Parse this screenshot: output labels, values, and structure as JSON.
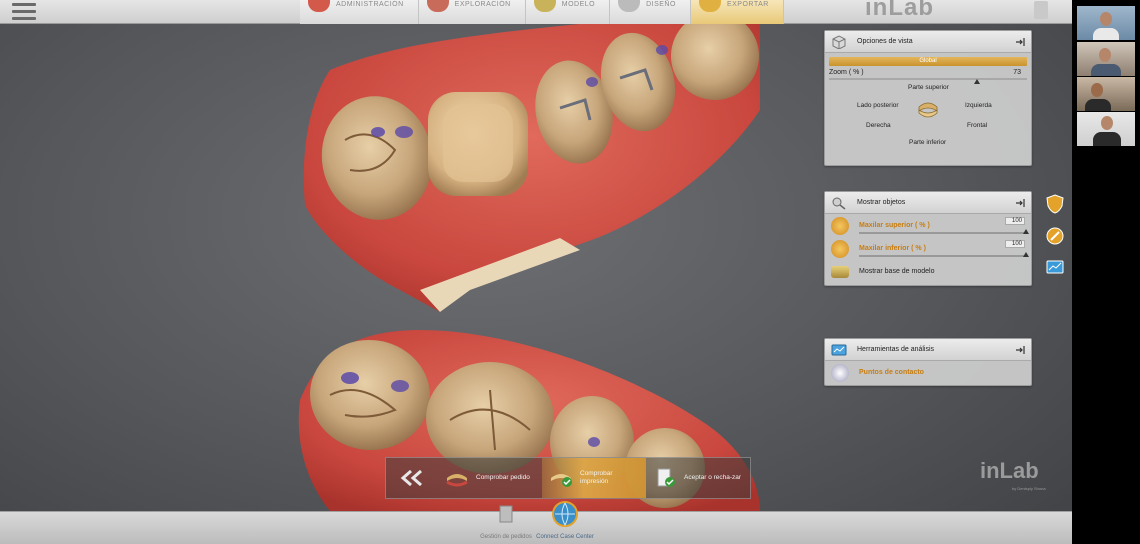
{
  "topbar": {
    "phases": [
      {
        "label": "ADMINISTRACIÓN",
        "color": "#d35a4a"
      },
      {
        "label": "EXPLORACIÓN",
        "color": "#c96b5a"
      },
      {
        "label": "MODELO",
        "color": "#c9b35a"
      },
      {
        "label": "DISEÑO",
        "color": "#aaaaaa"
      },
      {
        "label": "EXPORTAR",
        "color": "#e0b040"
      }
    ],
    "brand": "inLab"
  },
  "view_options": {
    "title": "Opciones de vista",
    "global_label": "Global",
    "zoom_label": "Zoom ( % )",
    "zoom_value": "73",
    "zoom_fraction": 0.73,
    "top_label": "Parte superior",
    "back_label": "Lado posterior",
    "left_label": "Izquierda",
    "right_label": "Derecha",
    "front_label": "Frontal",
    "bottom_label": "Parte inferior"
  },
  "show_objects": {
    "title": "Mostrar objetos",
    "upper_label": "Maxilar superior  ( % )",
    "upper_value": "100",
    "lower_label": "Maxilar inferior  ( % )",
    "lower_value": "100",
    "base_label": "Mostrar base de modelo"
  },
  "analysis_tools": {
    "title": "Herramientas de análisis",
    "contact_label": "Puntos de contacto"
  },
  "workflow": {
    "step1": "Comprobar pedido",
    "step2": "Comprobar impresión",
    "step3": "Aceptar o recha-zar"
  },
  "brand_bottom": "inLab",
  "brand_bottom_sub": "by Dentsply Sirona",
  "footer": {
    "orders": "Gestión de pedidos",
    "connect": "Connect Case Center"
  },
  "colors": {
    "accent_orange": "#d89a2e",
    "gum_red": "#c9473e",
    "tooth": "#c7a57a"
  }
}
